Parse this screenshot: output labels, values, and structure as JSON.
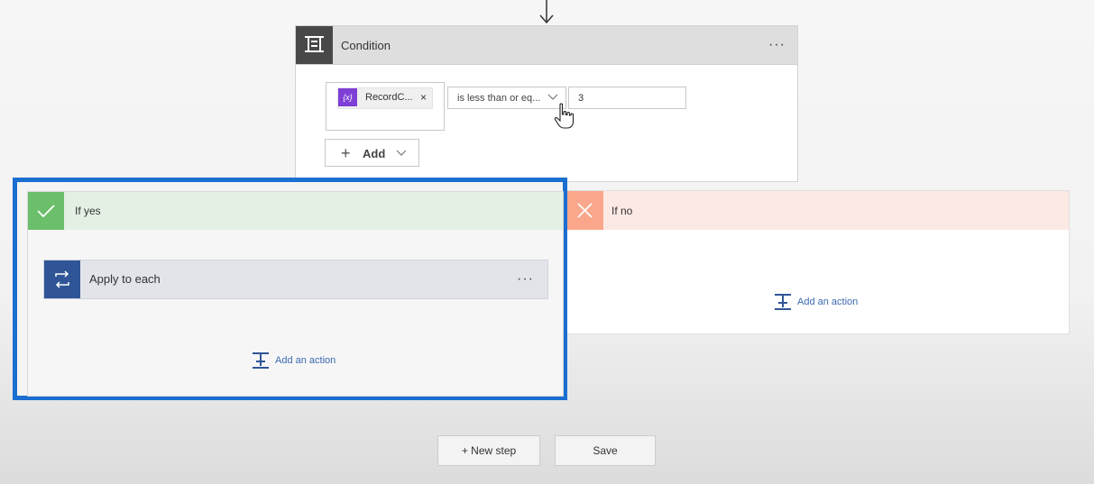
{
  "condition": {
    "title": "Condition",
    "more_label": "···",
    "left_operand": {
      "token_icon": "{x}",
      "token_label": "RecordC...",
      "remove_label": "×"
    },
    "operator": {
      "selected": "is less than or eq..."
    },
    "right_operand_value": "3",
    "add_button": {
      "plus": "+",
      "label": "Add"
    }
  },
  "branches": {
    "yes": {
      "title": "If yes",
      "actions": [
        {
          "title": "Apply to each",
          "more_label": "···"
        }
      ],
      "add_action_label": "Add an action"
    },
    "no": {
      "title": "If no",
      "add_action_label": "Add an action"
    }
  },
  "footer": {
    "new_step_label": "+ New step",
    "save_label": "Save"
  },
  "colors": {
    "highlight_border": "#1a6fd0",
    "condition_icon_bg": "#484848",
    "yes_accent": "#6bbf6b",
    "yes_header_bg": "#e3f0e3",
    "no_accent": "#f9a68b",
    "no_header_bg": "#fde9e4",
    "apply_icon_bg": "#2f5596",
    "token_icon_bg": "#7e3fd6",
    "link_blue": "#3a6ab0"
  },
  "icons": {
    "connector": "down-arrow-icon",
    "condition": "condition-icon",
    "variable": "variable-icon",
    "dropdown": "chevron-down-icon",
    "cursor": "hand-pointer-icon",
    "yes": "checkmark-icon",
    "no": "close-icon",
    "loop": "loop-icon",
    "add_action": "add-action-icon"
  }
}
